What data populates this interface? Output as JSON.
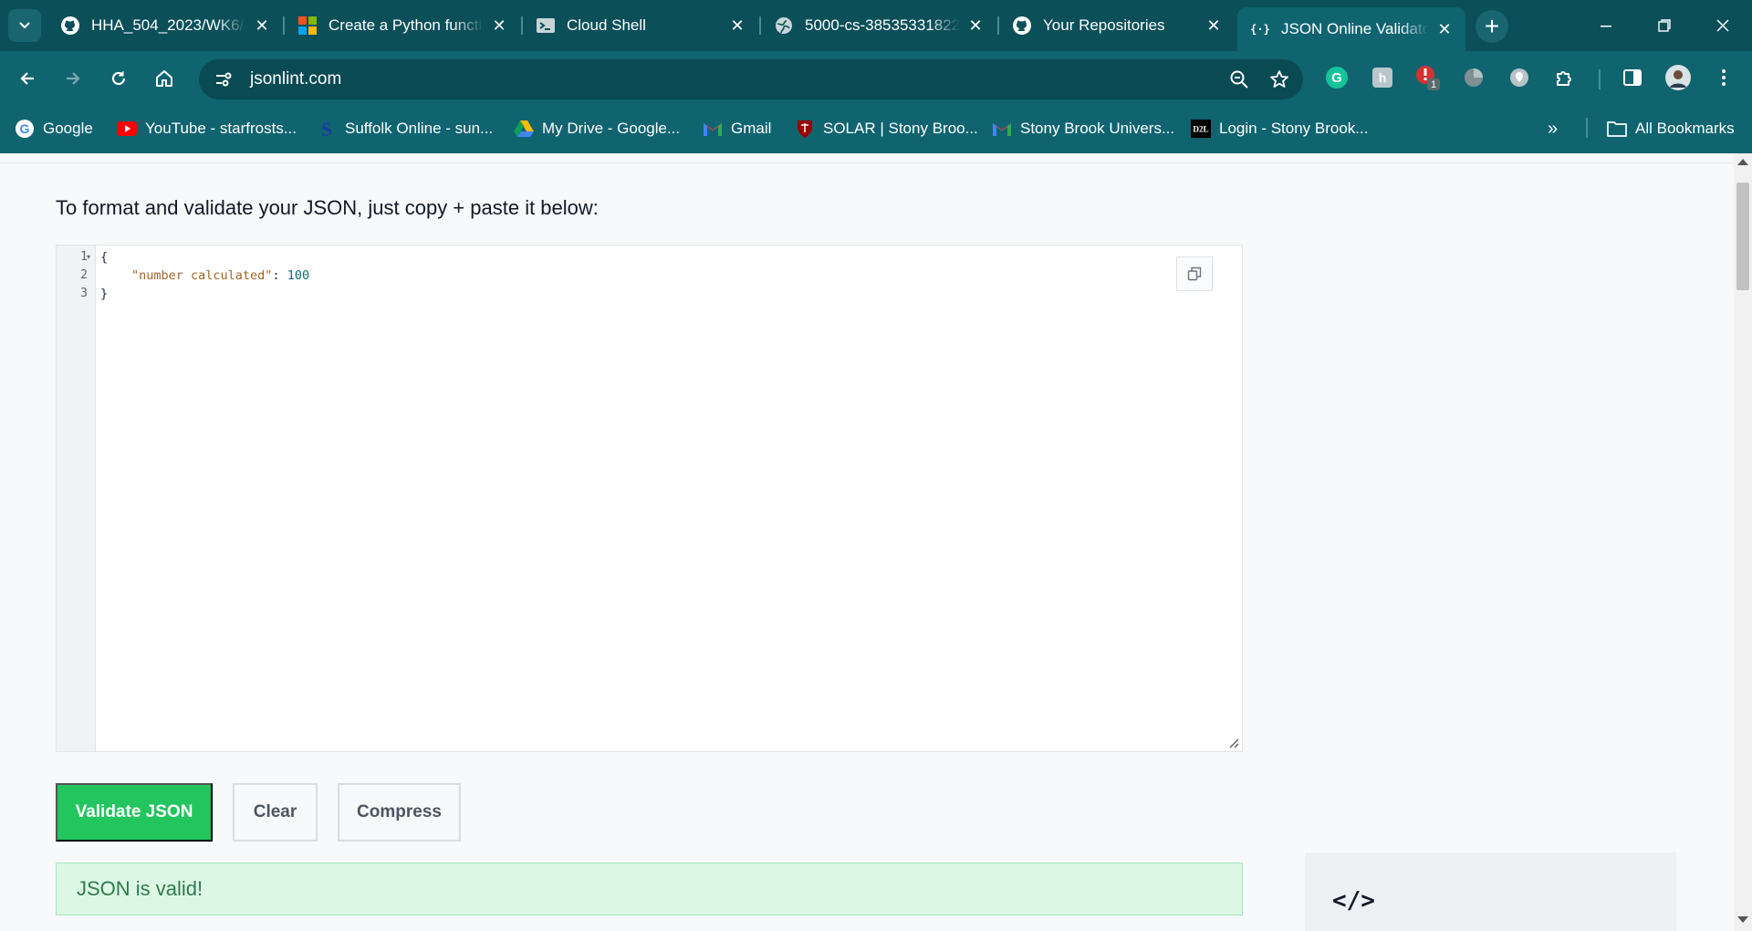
{
  "browser": {
    "tabs": [
      {
        "title": "HHA_504_2023/WK6/a",
        "icon": "github-icon"
      },
      {
        "title": "Create a Python functi",
        "icon": "microsoft-icon"
      },
      {
        "title": "Cloud Shell",
        "icon": "terminal-icon"
      },
      {
        "title": "5000-cs-38535331822",
        "icon": "globe-icon"
      },
      {
        "title": "Your Repositories",
        "icon": "github-icon"
      },
      {
        "title": "JSON Online Validator",
        "icon": "json-braces-icon",
        "active": true
      }
    ],
    "url": "jsonlint.com",
    "extension_badge": "1",
    "bookmarks": [
      {
        "label": "Google",
        "icon": "google-icon"
      },
      {
        "label": "YouTube - starfrosts...",
        "icon": "youtube-icon"
      },
      {
        "label": "Suffolk Online - sun...",
        "icon": "suffolk-icon"
      },
      {
        "label": "My Drive - Google...",
        "icon": "drive-icon"
      },
      {
        "label": "Gmail",
        "icon": "gmail-icon"
      },
      {
        "label": "SOLAR | Stony Broo...",
        "icon": "stony-brook-shield-icon"
      },
      {
        "label": "Stony Brook Univers...",
        "icon": "gmail-icon"
      },
      {
        "label": "Login - Stony Brook...",
        "icon": "d2l-icon"
      }
    ],
    "all_bookmarks_label": "All Bookmarks",
    "colors": {
      "chrome": "#0f6470",
      "tabstrip": "#0b4f59"
    }
  },
  "page": {
    "heading": "To format and validate your JSON, just copy + paste it below:",
    "editor": {
      "line_numbers": [
        "1",
        "2",
        "3"
      ],
      "lines": {
        "open": "{",
        "key": "\"number calculated\"",
        "colon": ": ",
        "value": "100",
        "close": "}"
      }
    },
    "buttons": {
      "validate": "Validate JSON",
      "clear": "Clear",
      "compress": "Compress"
    },
    "result": "JSON is valid!",
    "side_card_icon_text": "</>",
    "colors": {
      "validate": "#22c55e",
      "result_bg": "#dcf8e5",
      "result_text": "#2f7a4a"
    }
  }
}
